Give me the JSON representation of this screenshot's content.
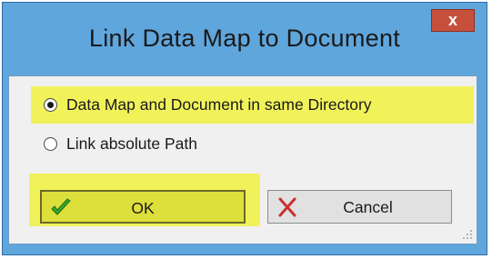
{
  "window": {
    "title": "Link Data Map to Document",
    "close_label": "x"
  },
  "options": [
    {
      "label": "Data Map and Document in same Directory",
      "checked": true
    },
    {
      "label": "Link absolute Path",
      "checked": false
    }
  ],
  "buttons": {
    "ok_label": "OK",
    "cancel_label": "Cancel"
  },
  "icons": {
    "ok": "checkmark-icon",
    "cancel": "cross-icon",
    "close": "close-icon",
    "grip": "resize-grip-icon"
  },
  "colors": {
    "titlebar": "#5fa6dd",
    "highlight": "#f1f25a",
    "close_button": "#c7503c",
    "ok_button": "#dddf3a",
    "checkmark": "#3aa52a",
    "cross": "#c83232"
  }
}
